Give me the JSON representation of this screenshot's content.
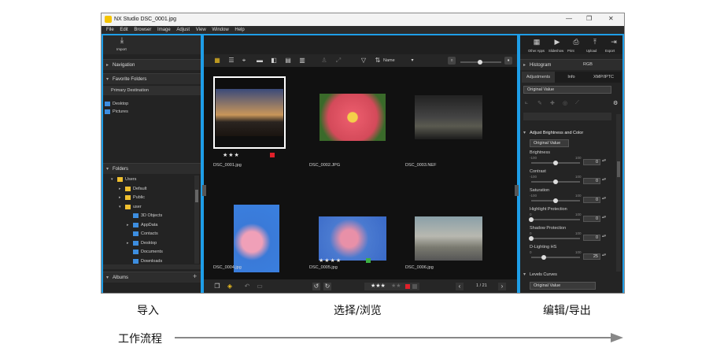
{
  "window": {
    "title": "NX Studio   DSC_0001.jpg",
    "minimize": "—",
    "restore": "❐",
    "close": "✕"
  },
  "menu": [
    "File",
    "Edit",
    "Browser",
    "Image",
    "Adjust",
    "View",
    "Window",
    "Help"
  ],
  "left_panel": {
    "import_label": "Import",
    "navigation": "Navigation",
    "favorite_folders": "Favorite Folders",
    "primary_destination": "Primary Destination",
    "desktop": "Desktop",
    "pictures": "Pictures",
    "folders": "Folders",
    "tree": [
      {
        "label": "Users",
        "indent": 0
      },
      {
        "label": "Default",
        "indent": 1
      },
      {
        "label": "Public",
        "indent": 1
      },
      {
        "label": "user",
        "indent": 1
      },
      {
        "label": "3D Objects",
        "indent": 2
      },
      {
        "label": "AppData",
        "indent": 2
      },
      {
        "label": "Contacts",
        "indent": 2
      },
      {
        "label": "Desktop",
        "indent": 2
      },
      {
        "label": "Documents",
        "indent": 2
      },
      {
        "label": "Downloads",
        "indent": 2
      }
    ],
    "albums": "Albums",
    "albums_add": "+"
  },
  "center_panel": {
    "sort_label": "Name",
    "thumbnails": [
      {
        "file": "DSC_0001.jpg",
        "stars": "★★★",
        "tag_color": "#e0202a",
        "selected": true
      },
      {
        "file": "DSC_0002.JPG",
        "stars": "",
        "tag_color": "",
        "selected": false
      },
      {
        "file": "DSC_0003.NEF",
        "stars": "",
        "tag_color": "",
        "selected": false
      },
      {
        "file": "DSC_0004.jpg",
        "stars": "",
        "tag_color": "",
        "selected": false
      },
      {
        "file": "DSC_0005.jpg",
        "stars": "★★★★",
        "tag_color": "#3cb043",
        "selected": false
      },
      {
        "file": "DSC_0006.jpg",
        "stars": "",
        "tag_color": "",
        "selected": false
      }
    ],
    "rating_filter": "★★★",
    "page_indicator": "1 / 21"
  },
  "right_panel": {
    "toolbar": [
      "Edit Video",
      "Other Apps",
      "Slideshow",
      "Print",
      "Upload",
      "Export"
    ],
    "histogram": "Histogram",
    "histogram_channel": "RGB",
    "tabs": [
      "Adjustments",
      "Info",
      "XMP/IPTC"
    ],
    "preset": "Original Value",
    "section_title": "Adjust Brightness and Color",
    "section_preset": "Original Value",
    "sliders": [
      {
        "label": "Brightness",
        "min": "-100",
        "max": "100",
        "value": "0",
        "level": 0.5
      },
      {
        "label": "Contrast",
        "min": "-100",
        "max": "100",
        "value": "0",
        "level": 0.5
      },
      {
        "label": "Saturation",
        "min": "-100",
        "max": "100",
        "value": "0",
        "level": 0.5
      },
      {
        "label": "Highlight Protection",
        "min": "0",
        "max": "100",
        "value": "0",
        "level": 0.0
      },
      {
        "label": "Shadow Protection",
        "min": "0",
        "max": "100",
        "value": "0",
        "level": 0.0
      },
      {
        "label": "D-Lighting HS",
        "min": "0",
        "max": "100",
        "value": "25",
        "level": 0.25
      }
    ],
    "levels_curves": "Levels Curves",
    "levels_preset": "Original Value"
  },
  "workflow": {
    "import_label": "导入",
    "select_label": "选择/浏览",
    "edit_label": "编辑/导出",
    "flow_label": "工作流程"
  },
  "colors": {
    "accent": "#1e9ee8",
    "panel": "#242424",
    "window_bg": "#1f1f1f"
  }
}
